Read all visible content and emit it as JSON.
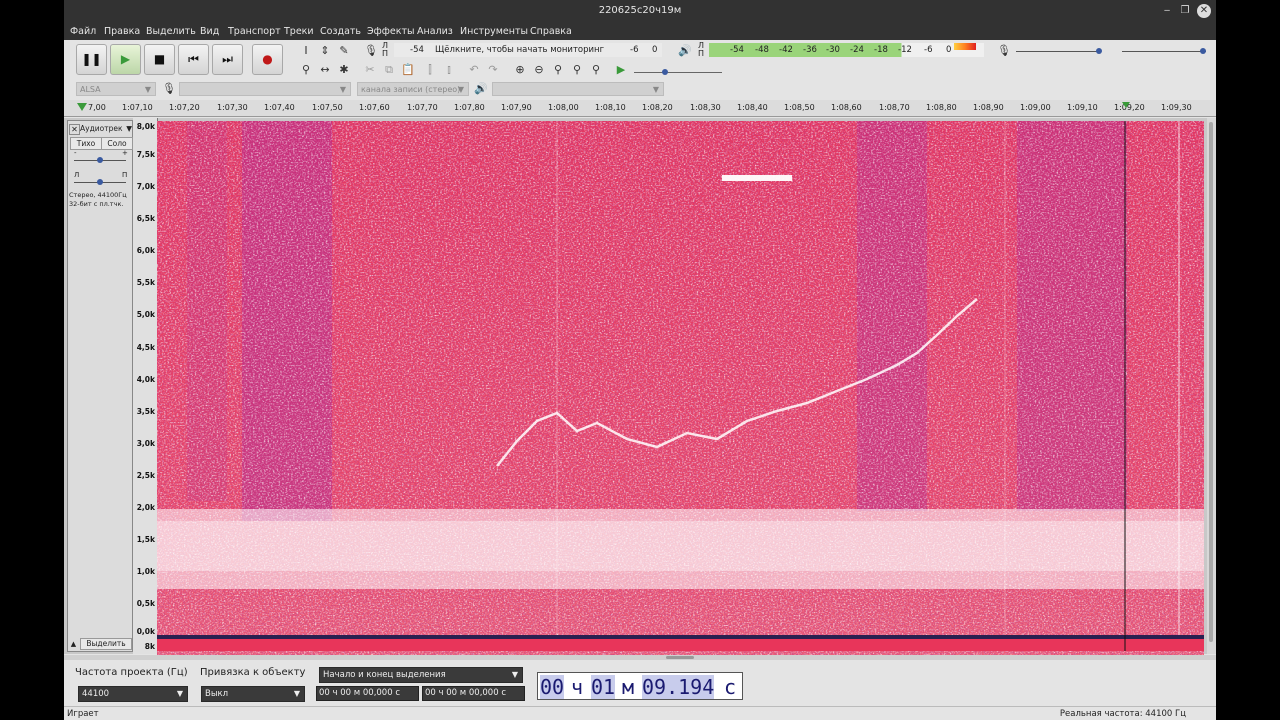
{
  "window": {
    "title": "220625с20ч19м"
  },
  "menu": [
    "Файл",
    "Правка",
    "Выделить",
    "Вид",
    "Транспорт",
    "Треки",
    "Создать",
    "Эффекты",
    "Анализ",
    "Инструменты",
    "Справка"
  ],
  "transport": {
    "pause": "pause-icon",
    "play": "play-icon",
    "stop": "stop-icon",
    "skip_start": "skip-start-icon",
    "skip_end": "skip-end-icon",
    "record": "record-icon"
  },
  "meters": {
    "rec_label": "Л\nП",
    "rec_ticks": [
      "-54",
      "Щёлкните, чтобы начать мониторинг",
      "-6",
      "0"
    ],
    "play_ticks": [
      "-54",
      "-48",
      "-42",
      "-36",
      "-30",
      "-24",
      "-18",
      "-12",
      "-6",
      "0"
    ]
  },
  "device": {
    "host": "ALSA",
    "channels": "канала записи (стерео)"
  },
  "ruler": [
    "7,00",
    "1:07,10",
    "1:07,20",
    "1:07,30",
    "1:07,40",
    "1:07,50",
    "1:07,60",
    "1:07,70",
    "1:07,80",
    "1:07,90",
    "1:08,00",
    "1:08,10",
    "1:08,20",
    "1:08,30",
    "1:08,40",
    "1:08,50",
    "1:08,60",
    "1:08,70",
    "1:08,80",
    "1:08,90",
    "1:09,00",
    "1:09,10",
    "1:09,20",
    "1:09,30"
  ],
  "track": {
    "name": "Аудиотрек",
    "mute": "Тихо",
    "solo": "Соло",
    "minus": "-",
    "plus": "+",
    "left": "Л",
    "right": "П",
    "info1": "Стерео, 44100Гц",
    "info2": "32-бит с пл.тчк.",
    "select": "Выделить"
  },
  "freq_scale": [
    "8,0k",
    "7,5k",
    "7,0k",
    "6,5k",
    "6,0k",
    "5,5k",
    "5,0k",
    "4,5k",
    "4,0k",
    "3,5k",
    "3,0k",
    "2,5k",
    "2,0k",
    "1,5k",
    "1,0k",
    "0,5k",
    "0,0k",
    "8k"
  ],
  "bottom": {
    "rate_label": "Частота проекта (Гц)",
    "rate_value": "44100",
    "snap_label": "Привязка к объекту",
    "snap_value": "Выкл",
    "sel_mode": "Начало и конец выделения",
    "sel_start": "00 ч 00 м 00,000 с",
    "sel_end": "00 ч 00 м 00,000 с",
    "time_h": "00",
    "time_hu": "ч",
    "time_m": "01",
    "time_mu": "м",
    "time_s": "09.194",
    "time_su": "с"
  },
  "status": {
    "left": "Играет",
    "right": "Реальная частота: 44100 Гц"
  }
}
